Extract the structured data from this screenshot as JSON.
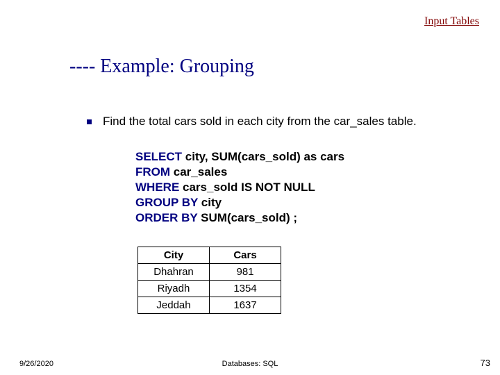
{
  "link_top": "Input Tables",
  "title": "---- Example: Grouping",
  "bullet_text": "Find the total cars sold in each city from the car_sales table.",
  "sql": {
    "line1": {
      "kw": "SELECT",
      "rest": " city, SUM(cars_sold) as cars"
    },
    "line2": {
      "kw": "FROM",
      "rest": " car_sales"
    },
    "line3": {
      "kw": "WHERE",
      "rest": " cars_sold IS NOT NULL"
    },
    "line4": {
      "kw": "GROUP BY",
      "rest": " city"
    },
    "line5": {
      "kw": "ORDER BY",
      "rest": " SUM(cars_sold) ;"
    }
  },
  "chart_data": {
    "type": "table",
    "columns": [
      "City",
      "Cars"
    ],
    "rows": [
      {
        "city": "Dhahran",
        "cars": 981
      },
      {
        "city": "Riyadh",
        "cars": 1354
      },
      {
        "city": "Jeddah",
        "cars": 1637
      }
    ]
  },
  "footer": {
    "date": "9/26/2020",
    "center": "Databases: SQL",
    "page": "73"
  }
}
